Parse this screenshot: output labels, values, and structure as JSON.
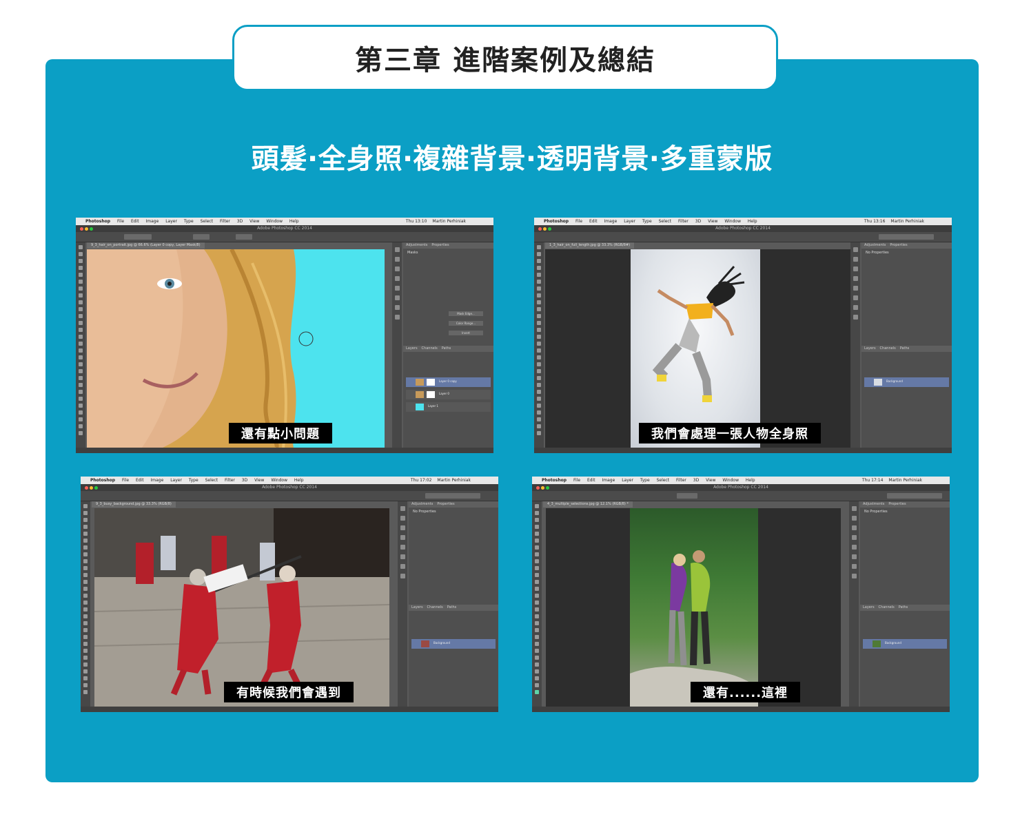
{
  "header": {
    "title": "第三章 進階案例及總結"
  },
  "subtitle": "頭髮‧全身照‧複雜背景‧透明背景‧多重蒙版",
  "colors": {
    "panel": "#0b9fc5",
    "tab_border": "#0b9fc5",
    "cyan_canvas": "#4de3ee",
    "caption_bg": "#000000",
    "layer_selected": "#6579a6"
  },
  "menubar": {
    "items": [
      "Photoshop",
      "File",
      "Edit",
      "Image",
      "Layer",
      "Type",
      "Select",
      "Filter",
      "3D",
      "View",
      "Window",
      "Help"
    ],
    "user": "Martin Perhiniak"
  },
  "window_title": "Adobe Photoshop CC 2014",
  "screenshots": [
    {
      "clock": "Thu 13:10",
      "doc_tab": "9_3_hair_on_portrait.jpg @ 66.6% (Layer 0 copy, Layer Mask/8)",
      "panel_tabs": [
        "Adjustments",
        "Properties"
      ],
      "properties_title": "Masks",
      "properties_buttons": [
        "Mask Edge...",
        "Color Range...",
        "Invert"
      ],
      "layers_tabs": [
        "Layers",
        "Channels",
        "Paths"
      ],
      "layers": [
        "Layer 0 copy",
        "Layer 0",
        "Layer 1"
      ],
      "caption": "還有點小問題"
    },
    {
      "clock": "Thu 13:16",
      "doc_tab": "1_3_hair_on_full_length.jpg @ 33.3% (RGB/8#)",
      "panel_tabs": [
        "Adjustments",
        "Properties"
      ],
      "properties_title": "No Properties",
      "layers_tabs": [
        "Layers",
        "Channels",
        "Paths"
      ],
      "layers": [
        "Background"
      ],
      "caption": "我們會處理一張人物全身照"
    },
    {
      "clock": "Thu 17:02",
      "doc_tab": "9_3_busy_background.jpg @ 33.3% (RGB/8)",
      "panel_tabs": [
        "Adjustments",
        "Properties"
      ],
      "properties_title": "No Properties",
      "layers_tabs": [
        "Layers",
        "Channels",
        "Paths"
      ],
      "layers": [
        "Background"
      ],
      "caption": "有時候我們會遇到"
    },
    {
      "clock": "Thu 17:14",
      "doc_tab": "4_3_multiple_selections.jpg @ 12.1% (RGB/8) *",
      "panel_tabs": [
        "Adjustments",
        "Properties"
      ],
      "properties_title": "No Properties",
      "layers_tabs": [
        "Layers",
        "Channels",
        "Paths"
      ],
      "layers": [
        "Background"
      ],
      "caption": "還有......這裡"
    }
  ]
}
